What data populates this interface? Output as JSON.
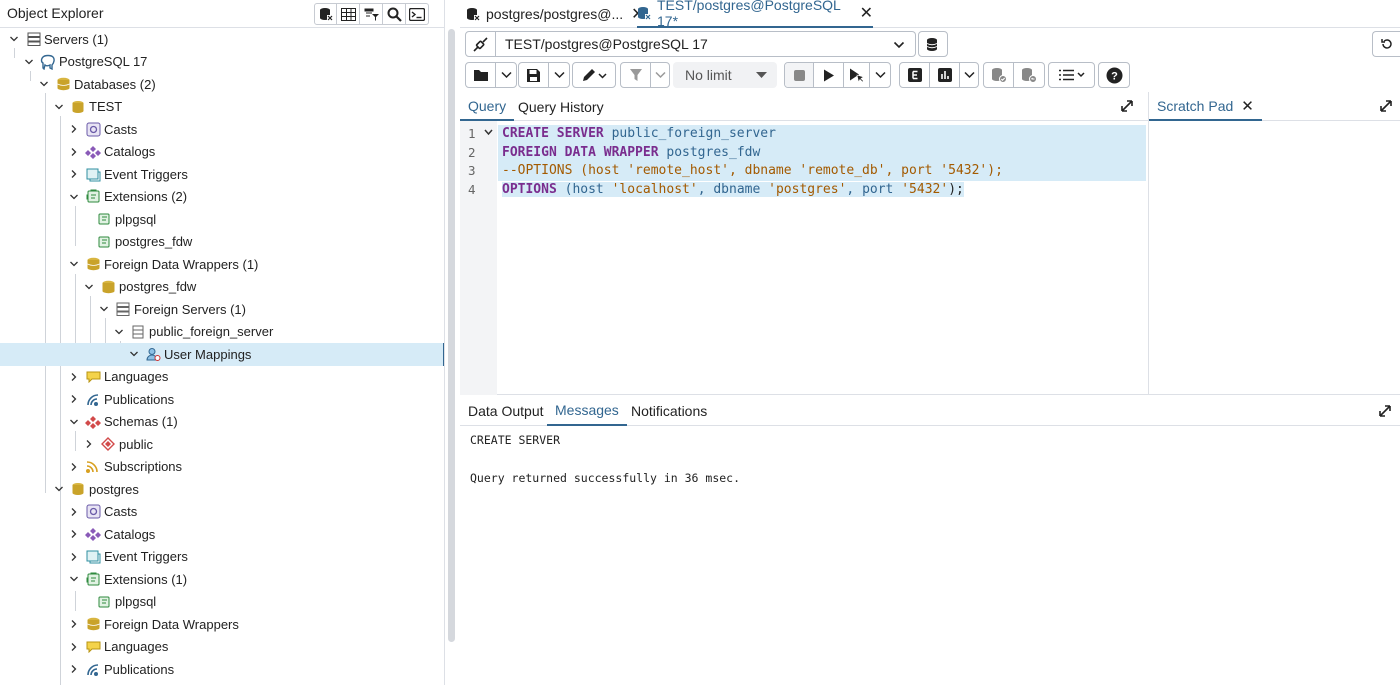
{
  "object_explorer": {
    "title": "Object Explorer",
    "tree": [
      {
        "label": "Servers (1)",
        "icon": "servers-icon"
      },
      {
        "label": "PostgreSQL 17",
        "icon": "elephant-icon"
      },
      {
        "label": "Databases (2)",
        "icon": "databases-icon"
      },
      {
        "label": "TEST",
        "icon": "database-icon"
      },
      {
        "label": "Casts",
        "icon": "casts-icon"
      },
      {
        "label": "Catalogs",
        "icon": "catalogs-icon"
      },
      {
        "label": "Event Triggers",
        "icon": "event-triggers-icon"
      },
      {
        "label": "Extensions (2)",
        "icon": "extensions-icon"
      },
      {
        "label": "plpgsql",
        "icon": "extension-icon"
      },
      {
        "label": "postgres_fdw",
        "icon": "extension-icon"
      },
      {
        "label": "Foreign Data Wrappers (1)",
        "icon": "fdw-icon"
      },
      {
        "label": "postgres_fdw",
        "icon": "fdw-item-icon"
      },
      {
        "label": "Foreign Servers (1)",
        "icon": "foreign-servers-icon"
      },
      {
        "label": "public_foreign_server",
        "icon": "foreign-server-icon"
      },
      {
        "label": "User Mappings",
        "icon": "user-mappings-icon"
      },
      {
        "label": "Languages",
        "icon": "languages-icon"
      },
      {
        "label": "Publications",
        "icon": "publications-icon"
      },
      {
        "label": "Schemas (1)",
        "icon": "schemas-icon"
      },
      {
        "label": "public",
        "icon": "schema-icon"
      },
      {
        "label": "Subscriptions",
        "icon": "subscriptions-icon"
      },
      {
        "label": "postgres",
        "icon": "database-icon"
      },
      {
        "label": "Casts",
        "icon": "casts-icon"
      },
      {
        "label": "Catalogs",
        "icon": "catalogs-icon"
      },
      {
        "label": "Event Triggers",
        "icon": "event-triggers-icon"
      },
      {
        "label": "Extensions (1)",
        "icon": "extensions-icon"
      },
      {
        "label": "plpgsql",
        "icon": "extension-icon"
      },
      {
        "label": "Foreign Data Wrappers",
        "icon": "fdw-icon"
      },
      {
        "label": "Languages",
        "icon": "languages-icon"
      },
      {
        "label": "Publications",
        "icon": "publications-icon"
      }
    ]
  },
  "tabs": [
    {
      "label": "postgres/postgres@...",
      "active": false
    },
    {
      "label": "TEST/postgres@PostgreSQL 17*",
      "active": true
    }
  ],
  "connection": {
    "value": "TEST/postgres@PostgreSQL 17"
  },
  "toolbar": {
    "limit_value": "No limit"
  },
  "query_tabs": {
    "query": "Query",
    "history": "Query History"
  },
  "scratch_pad": {
    "label": "Scratch Pad"
  },
  "editor": {
    "line_numbers": [
      "1",
      "2",
      "3",
      "4"
    ],
    "line1": {
      "kw": "CREATE SERVER",
      "name": "public_foreign_server"
    },
    "line2": {
      "kw": "FOREIGN DATA WRAPPER",
      "name": "postgres_fdw"
    },
    "line3": {
      "comment": "--OPTIONS (host 'remote_host', dbname 'remote_db', port '5432');"
    },
    "line4": {
      "kw": "OPTIONS",
      "p1": "(host ",
      "s1": "'localhost'",
      "p2": ", dbname ",
      "s2": "'postgres'",
      "p3": ", port ",
      "s3": "'5432'",
      "p4": ");"
    }
  },
  "output_tabs": {
    "data_output": "Data Output",
    "messages": "Messages",
    "notifications": "Notifications"
  },
  "output": {
    "line1": "CREATE SERVER",
    "line2": "Query returned successfully in 36 msec."
  },
  "colors": {
    "accent": "#326690",
    "selection": "#d6ebf7",
    "keyword": "#7a2d8e",
    "string": "#a35a00"
  }
}
